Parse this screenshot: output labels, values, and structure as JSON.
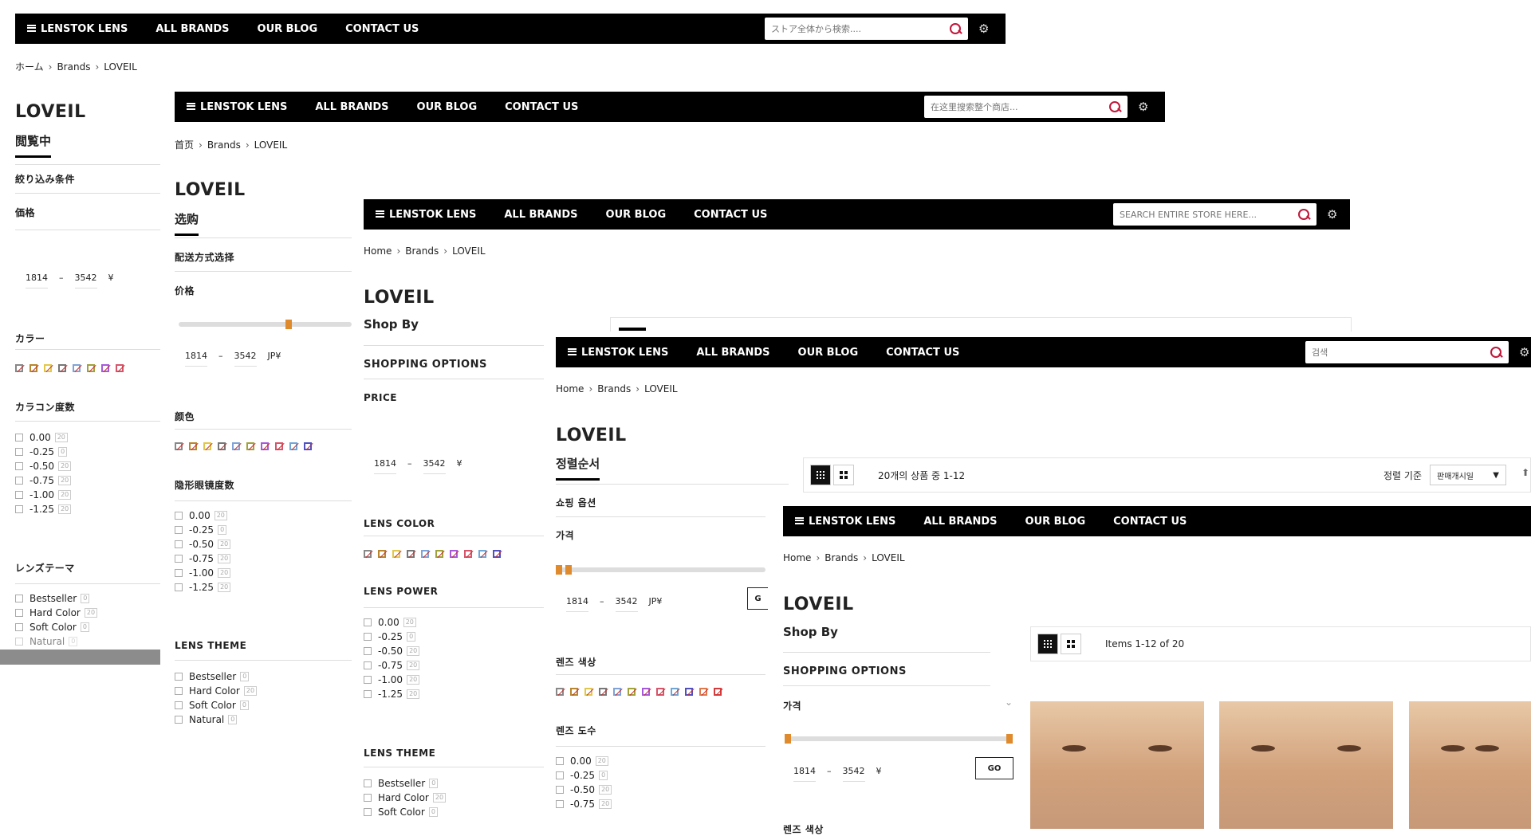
{
  "nav": {
    "brand": "LENSTOK LENS",
    "all_brands": "ALL BRANDS",
    "blog": "OUR BLOG",
    "contact": "CONTACT US"
  },
  "layers": [
    {
      "search_placeholder": "ストア全体から検索....",
      "crumb": [
        "ホーム",
        "Brands",
        "LOVEIL"
      ],
      "title": "LOVEIL",
      "subtitle": "閲覧中",
      "section": "絞り込み条件",
      "price_label": "価格",
      "price_from": "1814",
      "price_to": "3542",
      "currency": "¥",
      "color_label": "カラー",
      "power_label": "カラコン度数",
      "powers": [
        "0.00",
        "-0.25",
        "-0.50",
        "-0.75",
        "-1.00",
        "-1.25"
      ],
      "power_counts": [
        "20",
        "0",
        "20",
        "20",
        "20",
        "20"
      ],
      "theme_label": "レンズテーマ",
      "themes": [
        "Bestseller",
        "Hard Color",
        "Soft Color",
        "Natural"
      ],
      "theme_counts": [
        "0",
        "20",
        "0",
        "0"
      ]
    },
    {
      "search_placeholder": "在这里搜索整个商店...",
      "crumb": [
        "首页",
        "Brands",
        "LOVEIL"
      ],
      "title": "LOVEIL",
      "subtitle": "选购",
      "section": "配送方式选择",
      "price_label": "价格",
      "price_from": "1814",
      "price_to": "3542",
      "currency": "JP¥",
      "color_label": "颜色",
      "power_label": "隐形眼镜度数",
      "powers": [
        "0.00",
        "-0.25",
        "-0.50",
        "-0.75",
        "-1.00",
        "-1.25"
      ],
      "power_counts": [
        "20",
        "0",
        "20",
        "20",
        "20",
        "20"
      ],
      "theme_label": "LENS THEME",
      "themes": [
        "Bestseller",
        "Hard Color",
        "Soft Color",
        "Natural"
      ],
      "theme_counts": [
        "0",
        "20",
        "0",
        "0"
      ]
    },
    {
      "search_placeholder": "SEARCH ENTIRE STORE HERE...",
      "crumb": [
        "Home",
        "Brands",
        "LOVEIL"
      ],
      "title": "LOVEIL",
      "subtitle": "Shop By",
      "section": "SHOPPING OPTIONS",
      "price_label": "PRICE",
      "price_from": "1814",
      "price_to": "3542",
      "currency": "¥",
      "color_label": "LENS COLOR",
      "power_label": "LENS POWER",
      "powers": [
        "0.00",
        "-0.25",
        "-0.50",
        "-0.75",
        "-1.00",
        "-1.25"
      ],
      "power_counts": [
        "20",
        "0",
        "20",
        "20",
        "20",
        "20"
      ],
      "theme_label": "LENS THEME",
      "themes": [
        "Bestseller",
        "Hard Color",
        "Soft Color"
      ],
      "theme_counts": [
        "0",
        "20",
        "0"
      ]
    },
    {
      "search_placeholder": "검색",
      "crumb": [
        "Home",
        "Brands",
        "LOVEIL"
      ],
      "title": "LOVEIL",
      "subtitle": "정렬순서",
      "section": "쇼핑 옵션",
      "price_label": "가격",
      "price_from": "1814",
      "price_to": "3542",
      "currency": "JP¥",
      "go_label": "G",
      "color_label": "렌즈 색상",
      "power_label": "렌즈 도수",
      "powers": [
        "0.00",
        "-0.25",
        "-0.50",
        "-0.75"
      ],
      "power_counts": [
        "20",
        "0",
        "20",
        "20"
      ],
      "items_text": "20개의 상품 중 1-12",
      "sort_label": "정렬 기준",
      "sort_value": "판매개시일"
    },
    {
      "crumb": [
        "Home",
        "Brands",
        "LOVEIL"
      ],
      "title": "LOVEIL",
      "subtitle": "Shop By",
      "section": "SHOPPING OPTIONS",
      "price_label": "가격",
      "price_from": "1814",
      "price_to": "3542",
      "currency": "¥",
      "go_label": "GO",
      "items_text": "Items 1-12 of 20",
      "next_label": "렌즈 색상"
    }
  ]
}
